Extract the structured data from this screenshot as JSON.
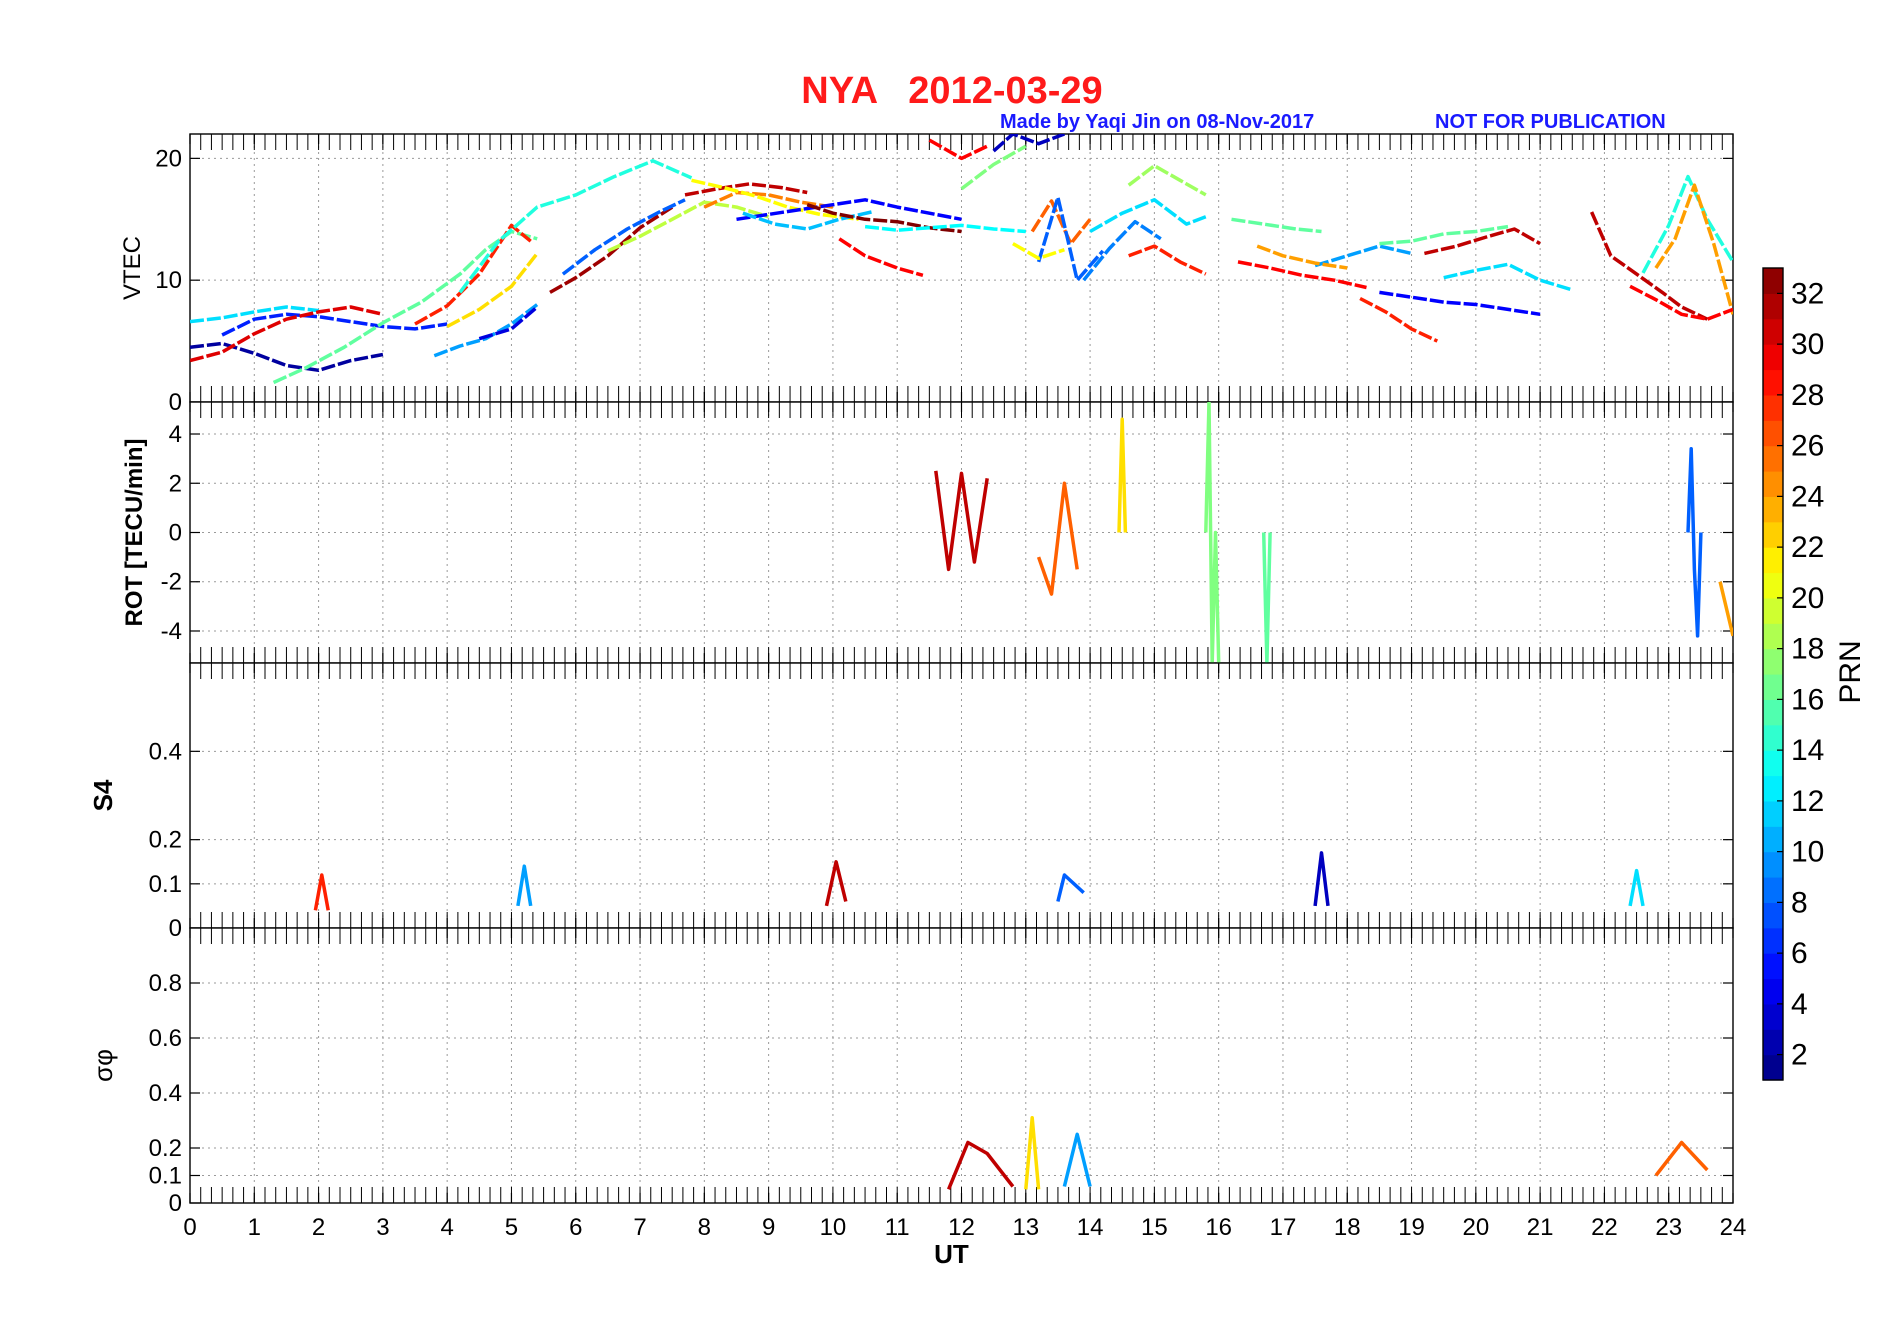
{
  "title": "NYA   2012-03-29",
  "credit": "Made by Yaqi Jin on 08-Nov-2017",
  "notice": "NOT FOR PUBLICATION",
  "colors": {
    "title": "#ff1a1a",
    "notes": "#1a1aff",
    "grid": "#9a9a9a"
  },
  "chart_data": [
    {
      "type": "line",
      "panel": "VTEC",
      "ylabel": "VTEC",
      "xlabel": "",
      "xlim": [
        0,
        24
      ],
      "ylim": [
        0,
        22
      ],
      "yticks": [
        0,
        10,
        20
      ],
      "grid": true,
      "series": [
        {
          "prn": 2,
          "x": [
            0,
            0.5,
            1,
            1.5,
            2,
            2.5,
            3
          ],
          "y": [
            4.5,
            4.8,
            4.0,
            3.0,
            2.6,
            3.4,
            3.9
          ]
        },
        {
          "prn": 6,
          "x": [
            0.5,
            1,
            1.5,
            2,
            2.5,
            3,
            3.5,
            4
          ],
          "y": [
            5.5,
            6.8,
            7.2,
            7.0,
            6.6,
            6.2,
            6.0,
            6.4
          ]
        },
        {
          "prn": 12,
          "x": [
            0,
            0.5,
            1,
            1.5,
            2
          ],
          "y": [
            6.6,
            6.9,
            7.4,
            7.8,
            7.5
          ]
        },
        {
          "prn": 16,
          "x": [
            1.3,
            1.8,
            2.4,
            3,
            3.6,
            4.2,
            4.6,
            5,
            5.4
          ],
          "y": [
            1.6,
            2.8,
            4.5,
            6.5,
            8.2,
            10.5,
            12.5,
            14.0,
            13.4
          ]
        },
        {
          "prn": 30,
          "x": [
            0,
            0.5,
            1,
            1.5,
            2,
            2.5,
            3
          ],
          "y": [
            3.4,
            4.1,
            5.6,
            6.8,
            7.4,
            7.8,
            7.2
          ]
        },
        {
          "prn": 28,
          "x": [
            3.5,
            4,
            4.5,
            5,
            5.3
          ],
          "y": [
            6.4,
            7.9,
            10.5,
            14.5,
            13.2
          ]
        },
        {
          "prn": 22,
          "x": [
            4,
            4.5,
            5,
            5.4
          ],
          "y": [
            6.2,
            7.6,
            9.5,
            12.2
          ]
        },
        {
          "prn": 10,
          "x": [
            3.8,
            4.2,
            4.6,
            5,
            5.4
          ],
          "y": [
            3.8,
            4.6,
            5.2,
            6.4,
            8.0
          ]
        },
        {
          "prn": 4,
          "x": [
            4.5,
            5,
            5.4
          ],
          "y": [
            5.2,
            6.0,
            7.8
          ]
        },
        {
          "prn": 14,
          "x": [
            4.2,
            4.8,
            5.4,
            6,
            6.6,
            7.2,
            7.8
          ],
          "y": [
            9.0,
            13.2,
            16.0,
            17.0,
            18.5,
            19.8,
            18.4
          ]
        },
        {
          "prn": 32,
          "x": [
            5.6,
            6,
            6.5,
            7,
            7.5
          ],
          "y": [
            9.0,
            10.2,
            12.0,
            14.3,
            16.0
          ]
        },
        {
          "prn": 8,
          "x": [
            5.8,
            6.3,
            6.8,
            7.3,
            7.7
          ],
          "y": [
            10.5,
            12.5,
            14.2,
            15.6,
            16.6
          ]
        },
        {
          "prn": 19,
          "x": [
            6.5,
            7,
            7.5,
            8,
            8.5,
            9
          ],
          "y": [
            12.4,
            13.6,
            15.0,
            16.4,
            16.0,
            15.2
          ]
        },
        {
          "prn": 31,
          "x": [
            7.7,
            8.2,
            8.7,
            9.2,
            9.6
          ],
          "y": [
            17.0,
            17.5,
            17.9,
            17.6,
            17.2
          ]
        },
        {
          "prn": 25,
          "x": [
            8,
            8.5,
            9,
            9.5,
            10
          ],
          "y": [
            16.0,
            17.2,
            17.0,
            16.4,
            16.0
          ]
        },
        {
          "prn": 21,
          "x": [
            7.8,
            8.3,
            8.8,
            9.3,
            9.8,
            10.4
          ],
          "y": [
            18.2,
            17.6,
            16.9,
            16.0,
            15.4,
            15.0
          ]
        },
        {
          "prn": 5,
          "x": [
            8.5,
            9,
            9.5,
            10,
            10.5,
            11,
            11.5,
            12
          ],
          "y": [
            15.0,
            15.4,
            15.8,
            16.2,
            16.6,
            16.0,
            15.5,
            15.0
          ]
        },
        {
          "prn": 11,
          "x": [
            8.6,
            9.1,
            9.6,
            10.1,
            10.6
          ],
          "y": [
            15.5,
            14.6,
            14.2,
            15.0,
            15.6
          ]
        },
        {
          "prn": 29,
          "x": [
            10.1,
            10.5,
            11,
            11.4
          ],
          "y": [
            13.4,
            12.0,
            11.0,
            10.4
          ]
        },
        {
          "prn": 33,
          "x": [
            9.6,
            10,
            10.5,
            11,
            11.5,
            12
          ],
          "y": [
            16.2,
            15.5,
            15.0,
            14.8,
            14.3,
            14.0
          ]
        },
        {
          "prn": 13,
          "x": [
            10.5,
            11,
            11.5,
            12,
            12.5,
            13
          ],
          "y": [
            14.4,
            14.1,
            14.3,
            14.5,
            14.2,
            14.0
          ]
        },
        {
          "prn": 29,
          "x": [
            11.5,
            12,
            12.4
          ],
          "y": [
            21.5,
            20.0,
            21.0
          ]
        },
        {
          "prn": 17,
          "x": [
            12,
            12.5,
            13
          ],
          "y": [
            17.5,
            19.5,
            21.0
          ]
        },
        {
          "prn": 3,
          "x": [
            12.5,
            12.8,
            13.2,
            13.6
          ],
          "y": [
            20.6,
            22.0,
            21.2,
            22.0
          ]
        },
        {
          "prn": 26,
          "x": [
            13.1,
            13.4,
            13.7,
            14
          ],
          "y": [
            14.0,
            16.5,
            13.0,
            15.0
          ]
        },
        {
          "prn": 8,
          "x": [
            13.2,
            13.5,
            13.8,
            14.2
          ],
          "y": [
            11.5,
            16.8,
            10.0,
            12.4
          ]
        },
        {
          "prn": 21,
          "x": [
            12.8,
            13.2,
            13.6
          ],
          "y": [
            13.0,
            11.8,
            12.5
          ]
        },
        {
          "prn": 18,
          "x": [
            14.6,
            15,
            15.4,
            15.8
          ],
          "y": [
            17.8,
            19.4,
            18.2,
            17.0
          ]
        },
        {
          "prn": 12,
          "x": [
            14,
            14.5,
            15,
            15.5,
            15.8
          ],
          "y": [
            14.0,
            15.5,
            16.6,
            14.6,
            15.2
          ]
        },
        {
          "prn": 9,
          "x": [
            13.9,
            14.3,
            14.7,
            15.1
          ],
          "y": [
            10.0,
            12.6,
            14.8,
            13.4
          ]
        },
        {
          "prn": 28,
          "x": [
            14.6,
            15,
            15.4,
            15.8
          ],
          "y": [
            12.0,
            12.8,
            11.5,
            10.5
          ]
        },
        {
          "prn": 16,
          "x": [
            16.2,
            16.7,
            17.2,
            17.6
          ],
          "y": [
            15.0,
            14.6,
            14.2,
            14.0
          ]
        },
        {
          "prn": 29,
          "x": [
            16.3,
            16.8,
            17.3,
            17.8,
            18.3
          ],
          "y": [
            11.5,
            11.0,
            10.4,
            10.0,
            9.4
          ]
        },
        {
          "prn": 10,
          "x": [
            17.5,
            18,
            18.5,
            19
          ],
          "y": [
            11.2,
            12.0,
            12.8,
            12.2
          ]
        },
        {
          "prn": 24,
          "x": [
            16.6,
            17,
            17.5,
            18
          ],
          "y": [
            12.8,
            12.0,
            11.4,
            11.0
          ]
        },
        {
          "prn": 28,
          "x": [
            18.2,
            18.6,
            19,
            19.4
          ],
          "y": [
            8.5,
            7.4,
            6.0,
            5.0
          ]
        },
        {
          "prn": 16,
          "x": [
            18.5,
            19,
            19.5,
            20,
            20.5
          ],
          "y": [
            13.0,
            13.2,
            13.8,
            14.0,
            14.4
          ]
        },
        {
          "prn": 5,
          "x": [
            18.5,
            19,
            19.5,
            20,
            20.5,
            21
          ],
          "y": [
            9.0,
            8.6,
            8.2,
            8.0,
            7.6,
            7.2
          ]
        },
        {
          "prn": 31,
          "x": [
            19.2,
            19.7,
            20.2,
            20.6,
            21
          ],
          "y": [
            12.2,
            12.8,
            13.6,
            14.2,
            13.0
          ]
        },
        {
          "prn": 12,
          "x": [
            19.5,
            20,
            20.5,
            21,
            21.5
          ],
          "y": [
            10.2,
            10.8,
            11.3,
            10.0,
            9.2
          ]
        },
        {
          "prn": 31,
          "x": [
            21.8,
            22.1,
            22.5,
            22.9,
            23.2,
            23.6
          ],
          "y": [
            15.6,
            12.0,
            10.5,
            9.0,
            7.8,
            6.8
          ]
        },
        {
          "prn": 14,
          "x": [
            22.6,
            23,
            23.3,
            23.6,
            24
          ],
          "y": [
            10.6,
            14.5,
            18.5,
            15.0,
            11.5
          ]
        },
        {
          "prn": 24,
          "x": [
            22.8,
            23.1,
            23.4,
            23.7,
            24
          ],
          "y": [
            11.0,
            13.4,
            17.8,
            13.0,
            7.2
          ]
        },
        {
          "prn": 29,
          "x": [
            22.4,
            22.8,
            23.2,
            23.6,
            24
          ],
          "y": [
            9.5,
            8.4,
            7.2,
            6.8,
            7.6
          ]
        }
      ]
    },
    {
      "type": "line",
      "panel": "ROT",
      "ylabel": "ROT [TECU/min]",
      "xlabel": "",
      "xlim": [
        0,
        24
      ],
      "ylim": [
        -5.3,
        5.3
      ],
      "yticks": [
        -4,
        -2,
        0,
        2,
        4
      ],
      "grid": true,
      "series": [
        {
          "prn": 8,
          "x": [
            23.3,
            23.35,
            23.4,
            23.45,
            23.5
          ],
          "y": [
            0,
            3.4,
            -1.5,
            -4.2,
            0
          ]
        },
        {
          "prn": 22,
          "x": [
            14.45,
            14.5,
            14.55
          ],
          "y": [
            0,
            4.6,
            0
          ]
        },
        {
          "prn": 17,
          "x": [
            15.8,
            15.85,
            15.9,
            15.95,
            16
          ],
          "y": [
            0,
            5.3,
            -5.3,
            0,
            -5.3
          ]
        },
        {
          "prn": 16,
          "x": [
            16.7,
            16.75,
            16.8
          ],
          "y": [
            0,
            -5.3,
            0
          ]
        },
        {
          "prn": 26,
          "x": [
            13.2,
            13.4,
            13.6,
            13.8
          ],
          "y": [
            -1.0,
            -2.5,
            2.0,
            -1.5
          ]
        },
        {
          "prn": 31,
          "x": [
            11.6,
            11.8,
            12,
            12.2,
            12.4
          ],
          "y": [
            2.5,
            -1.5,
            2.4,
            -1.2,
            2.2
          ]
        },
        {
          "prn": 24,
          "x": [
            23.8,
            24
          ],
          "y": [
            -2.0,
            -4.2
          ]
        }
      ]
    },
    {
      "type": "line",
      "panel": "S4",
      "ylabel": "S4",
      "xlabel": "",
      "xlim": [
        0,
        24
      ],
      "ylim": [
        0,
        0.6
      ],
      "yticks": [
        0,
        0.1,
        0.2,
        0.4
      ],
      "grid": true,
      "series": [
        {
          "prn": 28,
          "x": [
            1.95,
            2.05,
            2.15
          ],
          "y": [
            0.04,
            0.12,
            0.04
          ]
        },
        {
          "prn": 10,
          "x": [
            5.1,
            5.2,
            5.3
          ],
          "y": [
            0.05,
            0.14,
            0.05
          ]
        },
        {
          "prn": 31,
          "x": [
            9.9,
            10.05,
            10.2
          ],
          "y": [
            0.05,
            0.15,
            0.06
          ]
        },
        {
          "prn": 8,
          "x": [
            13.5,
            13.6,
            13.9
          ],
          "y": [
            0.06,
            0.12,
            0.08
          ]
        },
        {
          "prn": 3,
          "x": [
            17.5,
            17.6,
            17.7
          ],
          "y": [
            0.05,
            0.17,
            0.05
          ]
        },
        {
          "prn": 12,
          "x": [
            22.4,
            22.5,
            22.6
          ],
          "y": [
            0.05,
            0.13,
            0.05
          ]
        }
      ]
    },
    {
      "type": "line",
      "panel": "sigma-phi",
      "ylabel": "σφ",
      "xlabel": "UT",
      "xlim": [
        0,
        24
      ],
      "ylim": [
        0,
        1.0
      ],
      "yticks": [
        0,
        0.1,
        0.2,
        0.4,
        0.6,
        0.8
      ],
      "xticks": [
        0,
        1,
        2,
        3,
        4,
        5,
        6,
        7,
        8,
        9,
        10,
        11,
        12,
        13,
        14,
        15,
        16,
        17,
        18,
        19,
        20,
        21,
        22,
        23,
        24
      ],
      "grid": true,
      "series": [
        {
          "prn": 31,
          "x": [
            11.8,
            12.1,
            12.4,
            12.8
          ],
          "y": [
            0.05,
            0.22,
            0.18,
            0.06
          ]
        },
        {
          "prn": 22,
          "x": [
            13,
            13.1,
            13.2
          ],
          "y": [
            0.05,
            0.31,
            0.05
          ]
        },
        {
          "prn": 10,
          "x": [
            13.6,
            13.8,
            14
          ],
          "y": [
            0.06,
            0.25,
            0.06
          ]
        },
        {
          "prn": 26,
          "x": [
            22.8,
            23.2,
            23.6
          ],
          "y": [
            0.1,
            0.22,
            0.12
          ]
        }
      ]
    }
  ],
  "colorbar": {
    "label": "PRN",
    "range": [
      1,
      33
    ],
    "ticks": [
      2,
      4,
      6,
      8,
      10,
      12,
      14,
      16,
      18,
      20,
      22,
      24,
      26,
      28,
      30,
      32
    ]
  }
}
